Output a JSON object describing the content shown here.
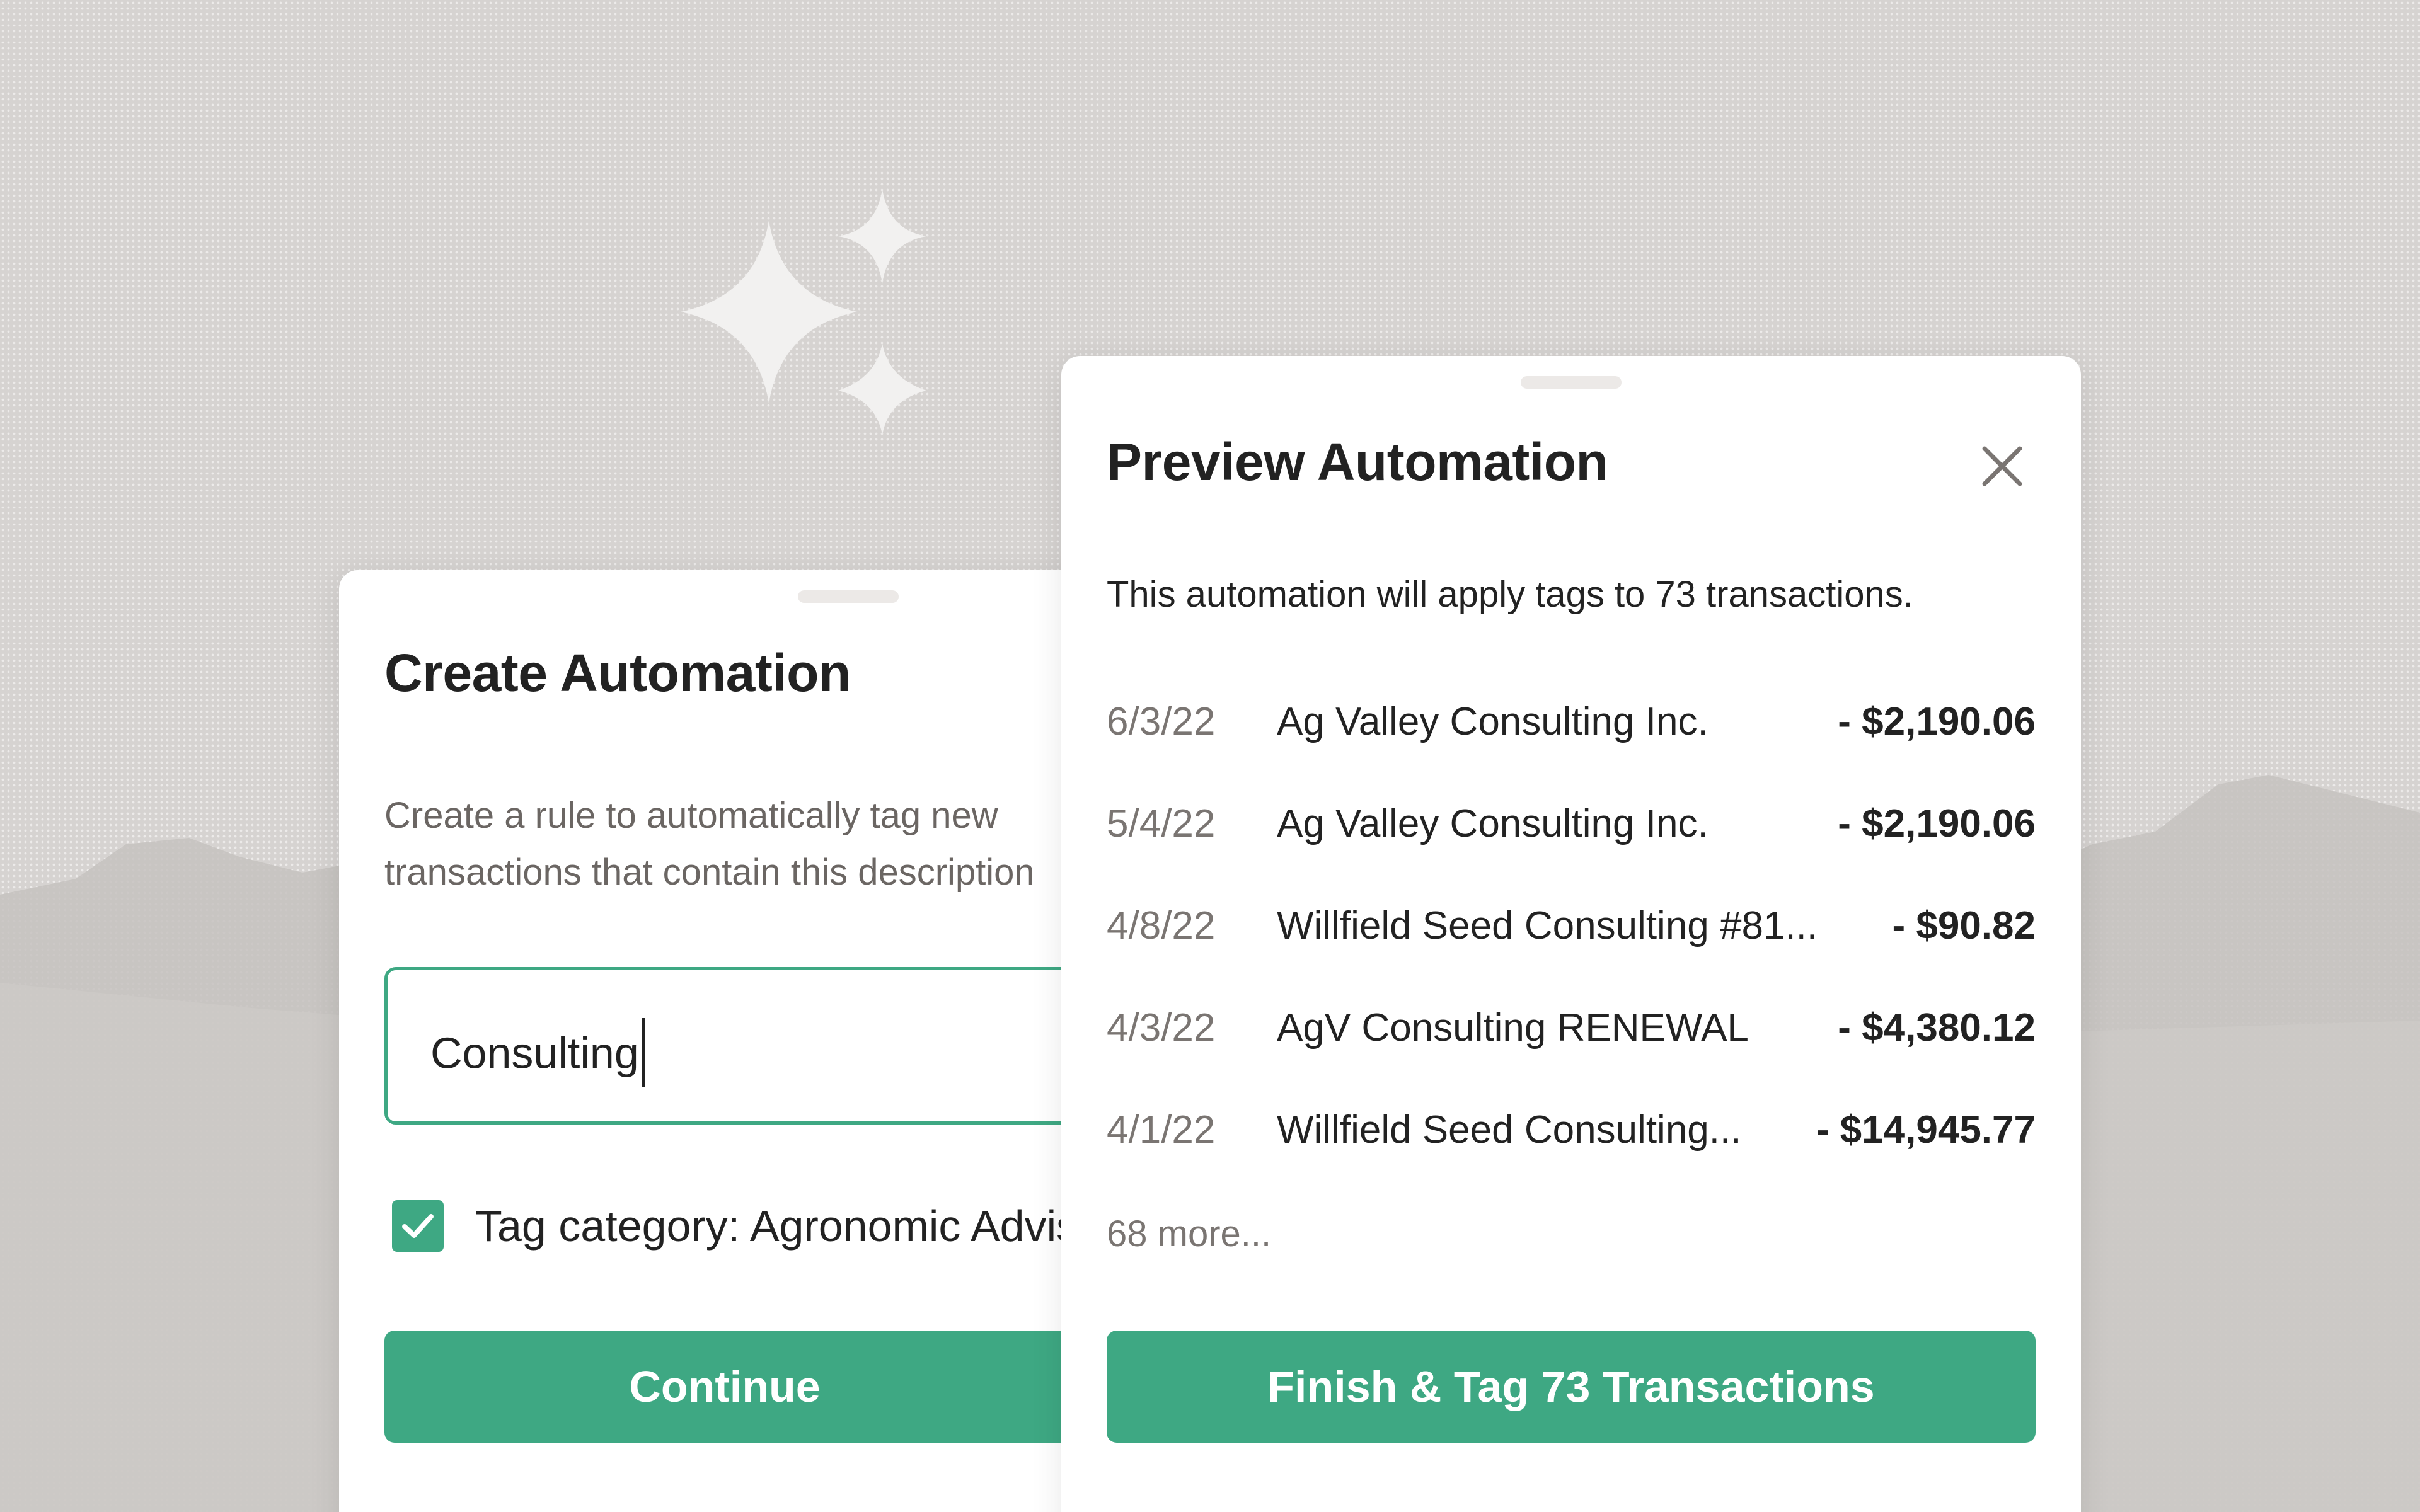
{
  "create_automation": {
    "title": "Create Automation",
    "description_line1": "Create a rule to automatically tag new",
    "description_line2": "transactions that contain this description",
    "input_value": "Consulting",
    "checkbox_checked": true,
    "checkbox_label": "Tag category: Agronomic Advisory",
    "continue_label": "Continue"
  },
  "preview_automation": {
    "title": "Preview Automation",
    "summary": "This automation will apply tags to 73 transactions.",
    "transactions": [
      {
        "date": "6/3/22",
        "name": "Ag Valley Consulting Inc.",
        "amount": "- $2,190.06"
      },
      {
        "date": "5/4/22",
        "name": "Ag Valley Consulting Inc.",
        "amount": "- $2,190.06"
      },
      {
        "date": "4/8/22",
        "name": "Willfield Seed Consulting #81...",
        "amount": "- $90.82"
      },
      {
        "date": "4/3/22",
        "name": "AgV Consulting RENEWAL",
        "amount": "- $4,380.12"
      },
      {
        "date": "4/1/22",
        "name": "Willfield Seed Consulting...",
        "amount": "- $14,945.77"
      }
    ],
    "more_label": "68 more...",
    "finish_label": "Finish & Tag 73 Transactions"
  },
  "colors": {
    "accent": "#3ea883",
    "background": "#d6d3d1",
    "text": "#222222",
    "muted_text": "#7a7572"
  },
  "icons": {
    "sparkles": "sparkles-icon",
    "close": "close-icon",
    "check": "checkmark-icon"
  }
}
